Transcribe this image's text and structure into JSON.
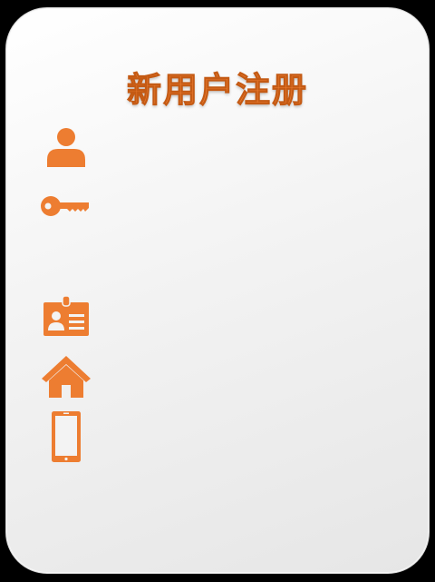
{
  "form": {
    "title": "新用户注册"
  },
  "icons": {
    "user": "user-icon",
    "password": "key-icon",
    "id_card": "id-card-icon",
    "address": "house-icon",
    "phone": "mobile-phone-icon"
  },
  "colors": {
    "accent": "#ed7d31",
    "card_background": "#f3f3f3",
    "page_background": "#000000"
  }
}
